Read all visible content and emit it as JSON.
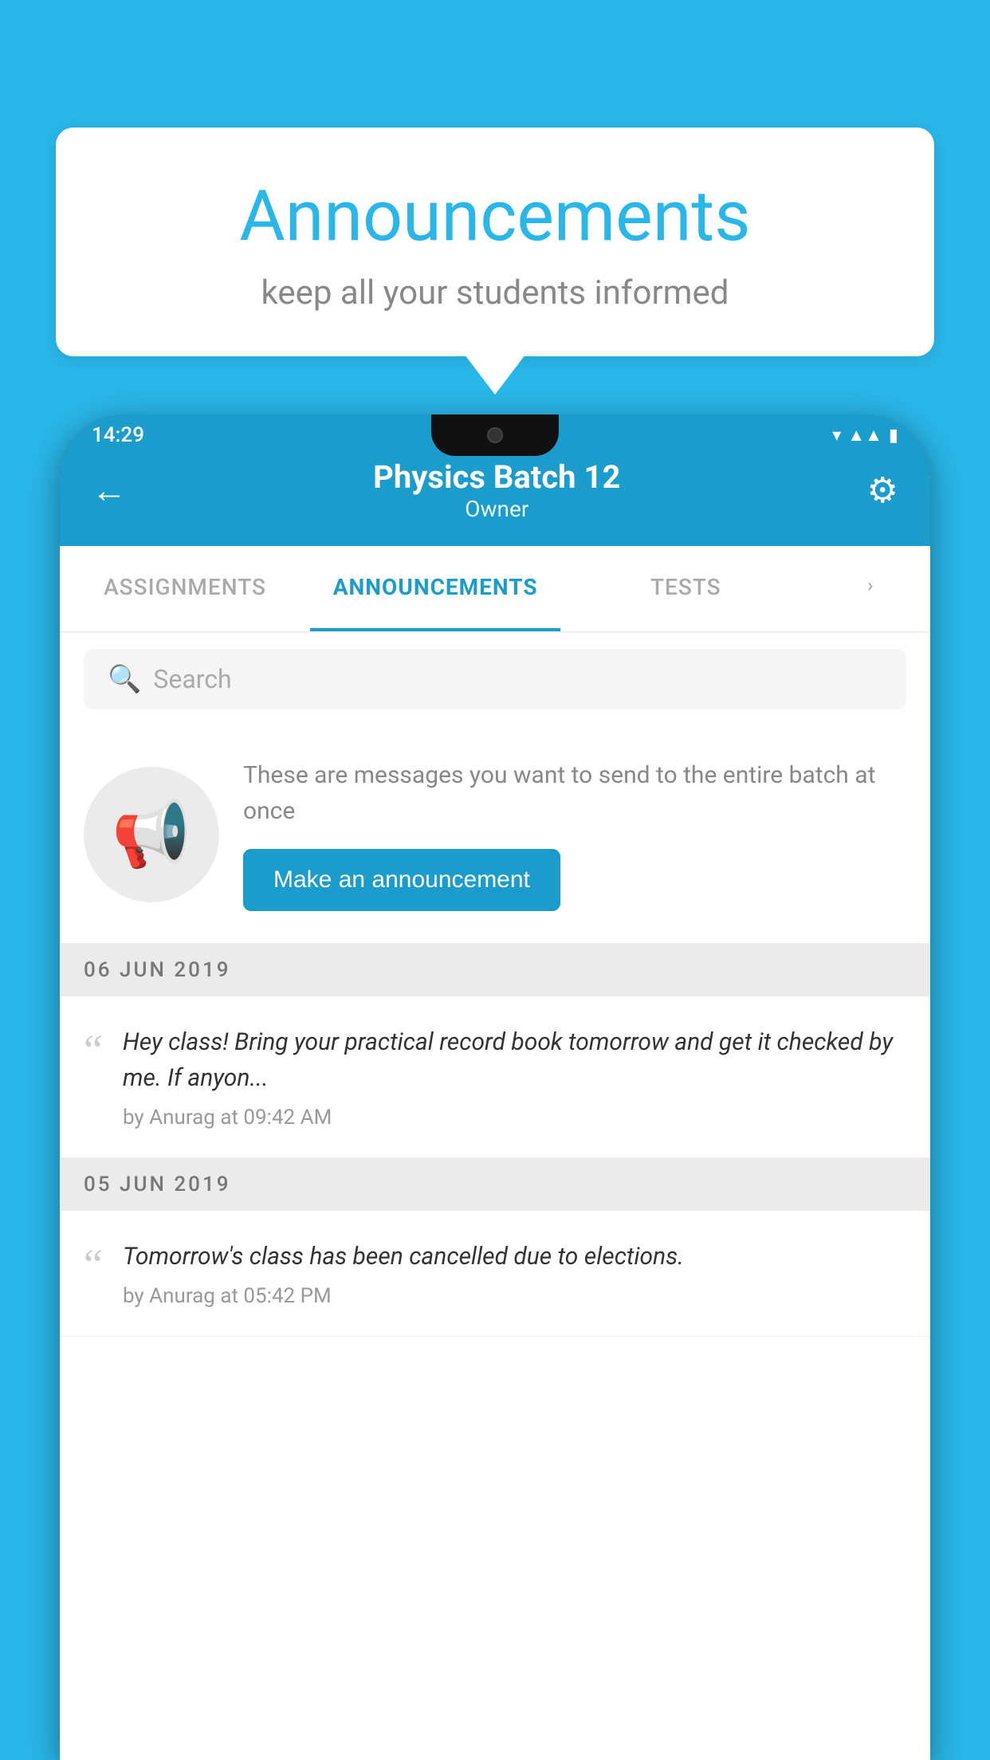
{
  "bubble": {
    "title": "Announcements",
    "subtitle": "keep all your students informed"
  },
  "phone": {
    "statusBar": {
      "time": "14:29"
    },
    "header": {
      "title": "Physics Batch 12",
      "subtitle": "Owner",
      "backLabel": "←",
      "gearLabel": "⚙"
    },
    "tabs": [
      {
        "label": "ASSIGNMENTS",
        "active": false
      },
      {
        "label": "ANNOUNCEMENTS",
        "active": true
      },
      {
        "label": "TESTS",
        "active": false
      },
      {
        "label": "•••",
        "active": false
      }
    ],
    "search": {
      "placeholder": "Search"
    },
    "promo": {
      "text": "These are messages you want to send to the entire batch at once",
      "buttonLabel": "Make an announcement"
    },
    "announcements": [
      {
        "date": "06  JUN  2019",
        "text": "Hey class! Bring your practical record book tomorrow and get it checked by me. If anyon...",
        "meta": "by Anurag at 09:42 AM"
      },
      {
        "date": "05  JUN  2019",
        "text": "Tomorrow's class has been cancelled due to elections.",
        "meta": "by Anurag at 05:42 PM"
      }
    ]
  }
}
